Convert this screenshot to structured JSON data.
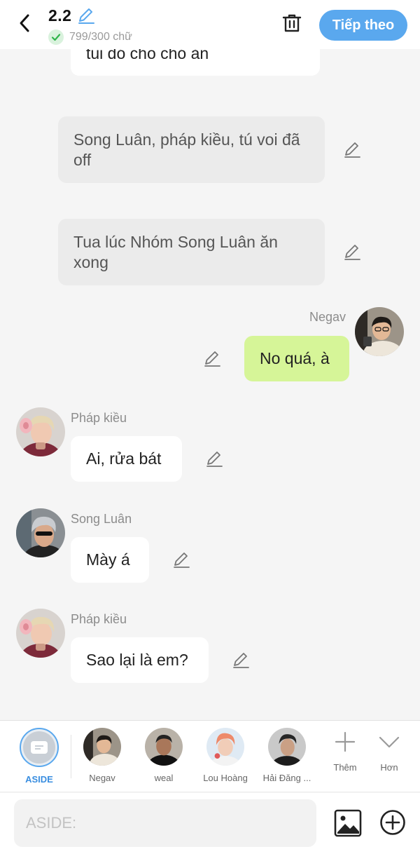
{
  "header": {
    "title": "2.2",
    "word_count": "799/300 chữ",
    "next_label": "Tiếp theo"
  },
  "messages": {
    "partial": {
      "text": "tui đó cho chó ăn"
    },
    "narration_1": {
      "text": "Song Luân, pháp kiều, tú voi đã off"
    },
    "narration_2": {
      "text": "Tua lúc Nhóm Song Luân ăn xong"
    },
    "msg_negav": {
      "speaker": "Negav",
      "text": "No quá, à"
    },
    "msg_phapkieu_1": {
      "speaker": "Pháp kiều",
      "text": "Ai, rửa bát"
    },
    "msg_songluan": {
      "speaker": "Song Luân",
      "text": "Mày á"
    },
    "msg_phapkieu_2": {
      "speaker": "Pháp kiều",
      "text": "Sao lại là em?"
    }
  },
  "characters": {
    "aside": "ASIDE",
    "items": [
      "Negav",
      "weal",
      "Lou Hoàng",
      "Hải Đăng ..."
    ],
    "add_label": "Thêm",
    "more_label": "Hơn"
  },
  "input": {
    "placeholder": "ASIDE:"
  },
  "colors": {
    "accent": "#5aa8ee",
    "green_bubble": "#d6f598",
    "narration_bubble": "#ebebeb",
    "background": "#f5f5f5"
  },
  "icons": [
    "back-arrow-icon",
    "pencil-icon",
    "check-icon",
    "trash-icon",
    "image-icon",
    "plus-circle-icon",
    "plus-icon",
    "chevron-down-icon"
  ]
}
